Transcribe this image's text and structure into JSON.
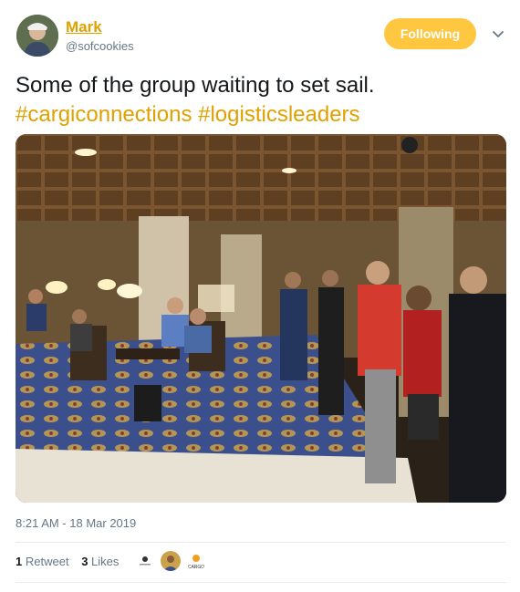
{
  "author": {
    "name": "Mark",
    "handle": "@sofcookies",
    "follow_label": "Following"
  },
  "tweet": {
    "text": "Some of the group waiting to set sail.",
    "hashtags": [
      "#cargiconnections",
      "#logisticsleaders"
    ],
    "timestamp": "8:21 AM - 18 Mar 2019"
  },
  "engagement": {
    "retweets_count": "1",
    "retweets_label": "Retweet",
    "likes_count": "3",
    "likes_label": "Likes"
  },
  "liker_avatars": [
    {
      "icon": "logo-avatar-1"
    },
    {
      "icon": "person-avatar"
    },
    {
      "icon": "cargo-logo-avatar"
    }
  ],
  "liker_avatar_texts": [
    "CARGO"
  ],
  "colors": {
    "accent": "#e0a100",
    "follow_button": "#ffc63f",
    "muted_text": "#657786",
    "divider": "#e6ecf0"
  }
}
